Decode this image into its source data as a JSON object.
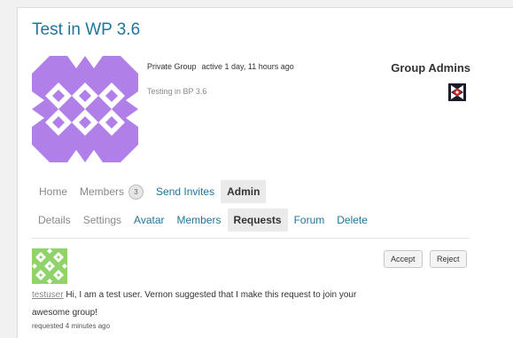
{
  "group": {
    "title": "Test in WP 3.6",
    "type": "Private Group",
    "activity": "active 1 day, 11 hours ago",
    "description": "Testing in BP 3.6"
  },
  "admins": {
    "title": "Group Admins"
  },
  "nav": {
    "home": "Home",
    "members": "Members",
    "members_count": "3",
    "send_invites": "Send Invites",
    "admin": "Admin"
  },
  "subnav": {
    "details": "Details",
    "settings": "Settings",
    "avatar": "Avatar",
    "members": "Members",
    "requests": "Requests",
    "forum": "Forum",
    "delete": "Delete"
  },
  "request": {
    "username": "testuser",
    "message": " Hi, I am a test user. Vernon suggested that I make this request to join your awesome group!",
    "time": "requested 4 minutes ago",
    "accept_label": "Accept",
    "reject_label": "Reject"
  },
  "colors": {
    "accent_link": "#21759b",
    "group_avatar": "#b07fe8",
    "user_avatar": "#8fd36a"
  }
}
